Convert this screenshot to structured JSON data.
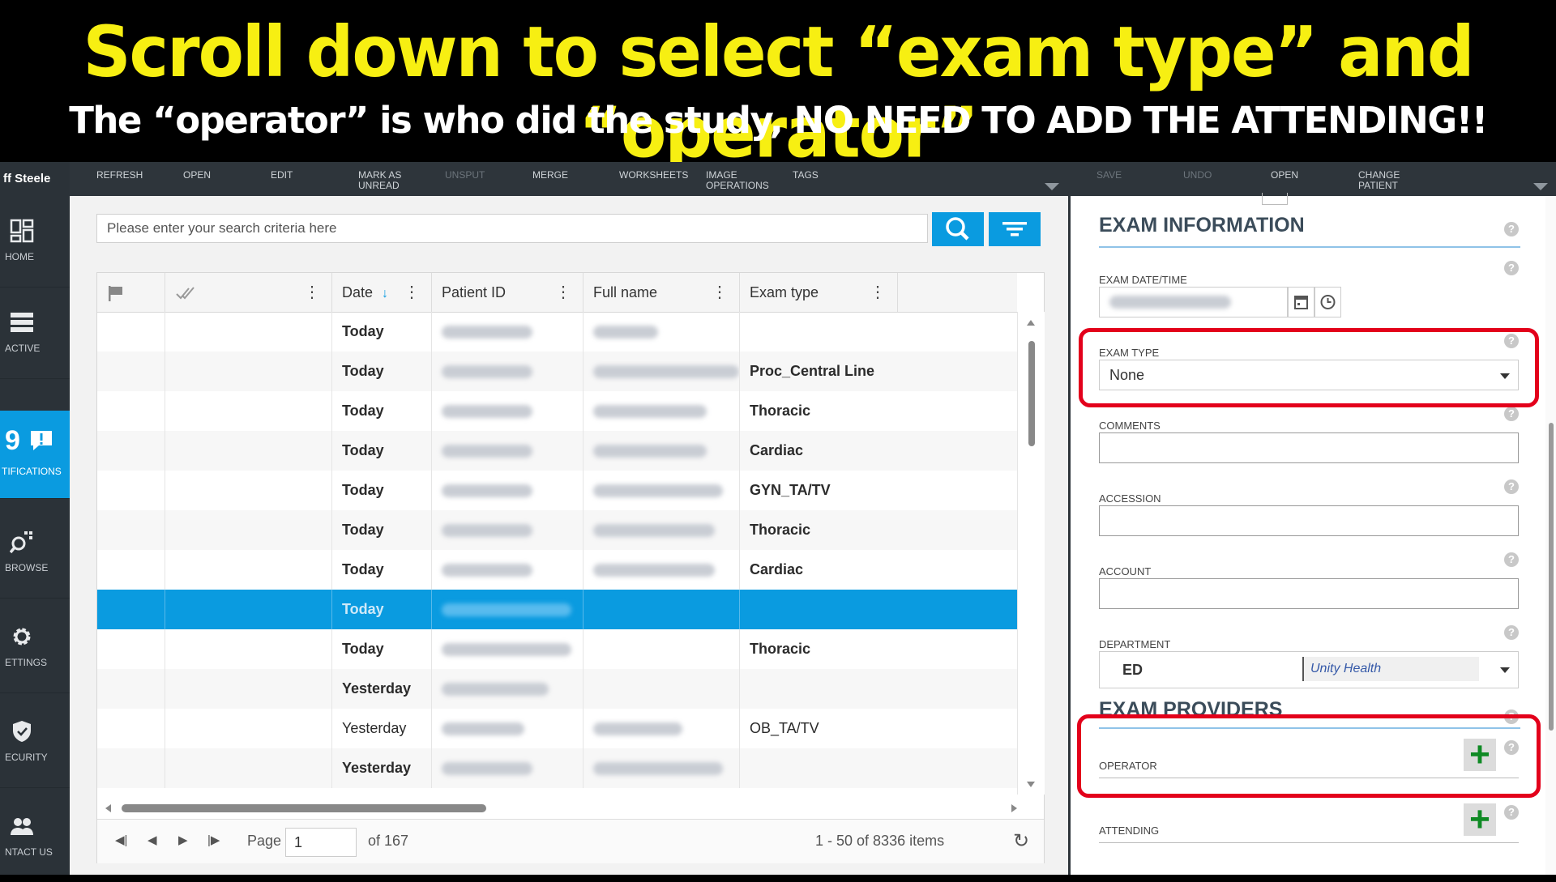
{
  "banner": {
    "headline": "Scroll down to select “exam type” and “operator”",
    "subline": "The “operator” is who did the study, NO NEED TO ADD THE ATTENDING!!"
  },
  "user": {
    "name_fragment": "ff Steele"
  },
  "sidebar": {
    "items": [
      {
        "label": "HOME",
        "icon": "dashboard-icon"
      },
      {
        "label": "ACTIVE",
        "icon": "list-icon"
      },
      {
        "label": "TIFICATIONS",
        "count": "9",
        "icon": "message-alert-icon"
      },
      {
        "label": "BROWSE",
        "icon": "browse-search-icon"
      },
      {
        "label": "ETTINGS",
        "icon": "gear-icon"
      },
      {
        "label": "ECURITY",
        "icon": "shield-icon"
      },
      {
        "label": "NTACT US",
        "icon": "people-icon"
      }
    ]
  },
  "toolbar_left": {
    "refresh": "REFRESH",
    "open": "OPEN",
    "edit": "EDIT",
    "mark_as_unread_1": "MARK AS",
    "mark_as_unread_2": "UNREAD",
    "unsput": "UNSPUT",
    "merge": "MERGE",
    "worksheets": "WORKSHEETS",
    "image_ops_1": "IMAGE",
    "image_ops_2": "OPERATIONS",
    "tags": "TAGS"
  },
  "toolbar_right": {
    "save": "SAVE",
    "undo": "UNDO",
    "open": "OPEN",
    "change_patient_1": "CHANGE",
    "change_patient_2": "PATIENT"
  },
  "search": {
    "placeholder": "Please enter your search criteria here"
  },
  "grid": {
    "columns": [
      "Date",
      "Patient ID",
      "Full name",
      "Exam type"
    ],
    "sort_indicator": "↓",
    "rows": [
      {
        "date": "Today",
        "exam_type": "",
        "bold": true
      },
      {
        "date": "Today",
        "exam_type": "Proc_Central Line",
        "bold": true
      },
      {
        "date": "Today",
        "exam_type": "Thoracic",
        "bold": true
      },
      {
        "date": "Today",
        "exam_type": "Cardiac",
        "bold": true
      },
      {
        "date": "Today",
        "exam_type": "GYN_TA/TV",
        "bold": true
      },
      {
        "date": "Today",
        "exam_type": "Thoracic",
        "bold": true
      },
      {
        "date": "Today",
        "exam_type": "Cardiac",
        "bold": true
      },
      {
        "date": "Today",
        "exam_type": "",
        "bold": true,
        "selected": true
      },
      {
        "date": "Today",
        "exam_type": "Thoracic",
        "bold": true
      },
      {
        "date": "Yesterday",
        "exam_type": "",
        "bold": true
      },
      {
        "date": "Yesterday",
        "exam_type": "OB_TA/TV",
        "bold": false
      },
      {
        "date": "Yesterday",
        "exam_type": "",
        "bold": true
      }
    ]
  },
  "pager": {
    "page_label": "Page",
    "page_value": "1",
    "of_label": "of 167",
    "items_summary": "1 - 50 of 8336 items"
  },
  "panel": {
    "exam_info_title": "EXAM INFORMATION",
    "exam_datetime_label": "EXAM DATE/TIME",
    "exam_type_label": "EXAM TYPE",
    "exam_type_value": "None",
    "comments_label": "COMMENTS",
    "accession_label": "ACCESSION",
    "account_label": "ACCOUNT",
    "department_label": "DEPARTMENT",
    "department_value": "ED",
    "department_org": "Unity Health",
    "providers_title": "EXAM PROVIDERS",
    "operator_label": "OPERATOR",
    "attending_label": "ATTENDING"
  },
  "colors": {
    "accent": "#0a9be0",
    "highlight": "#e3001b",
    "headline": "#f7ef12",
    "add": "#0f8a24"
  }
}
